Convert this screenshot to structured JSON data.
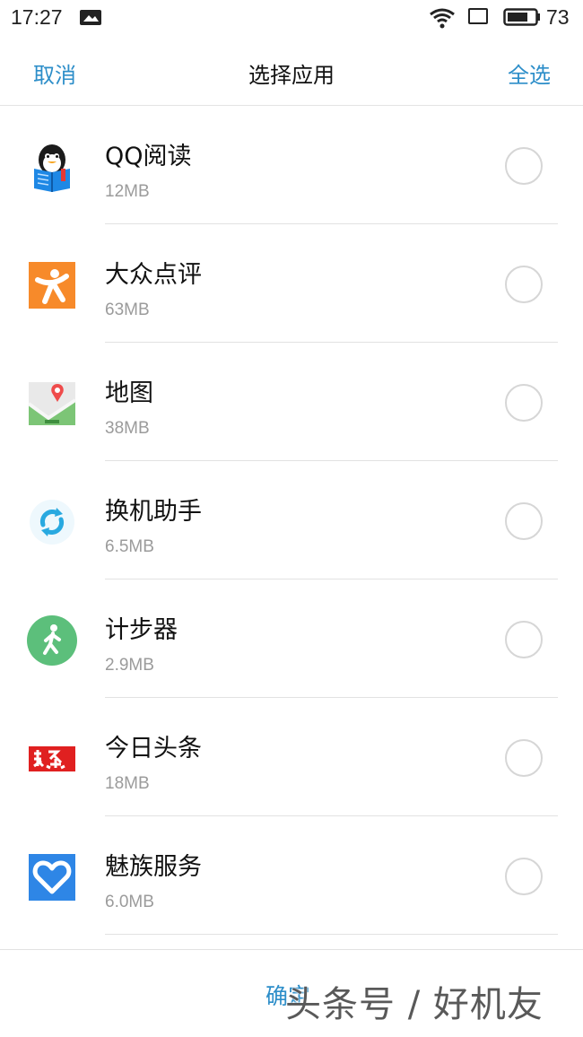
{
  "status_bar": {
    "time": "17:27",
    "battery_level": "73"
  },
  "header": {
    "cancel_label": "取消",
    "title": "选择应用",
    "select_all_label": "全选"
  },
  "apps": [
    {
      "name": "QQ阅读",
      "size": "12MB",
      "icon": "qq-reading-icon",
      "selected": false
    },
    {
      "name": "大众点评",
      "size": "63MB",
      "icon": "dianping-icon",
      "selected": false
    },
    {
      "name": "地图",
      "size": "38MB",
      "icon": "map-icon",
      "selected": false
    },
    {
      "name": "换机助手",
      "size": "6.5MB",
      "icon": "phone-transfer-icon",
      "selected": false
    },
    {
      "name": "计步器",
      "size": "2.9MB",
      "icon": "pedometer-icon",
      "selected": false
    },
    {
      "name": "今日头条",
      "size": "18MB",
      "icon": "toutiao-icon",
      "selected": false
    },
    {
      "name": "魅族服务",
      "size": "6.0MB",
      "icon": "meizu-service-icon",
      "selected": false
    }
  ],
  "footer": {
    "confirm_label": "确定",
    "watermark": "头条号 / 好机友"
  },
  "colors": {
    "accent": "#2d8ec9",
    "secondary_text": "#9b9b9b",
    "divider": "#e2e2e2"
  }
}
